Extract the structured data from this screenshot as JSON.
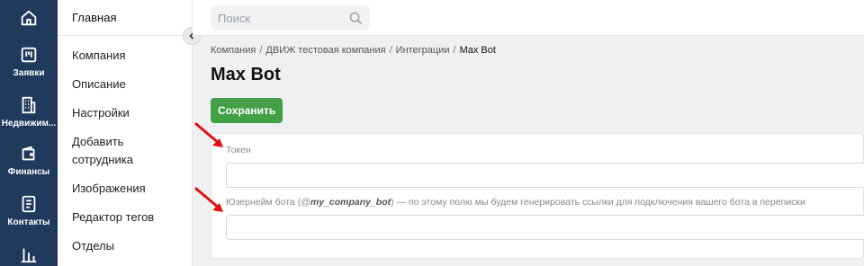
{
  "rail": {
    "items": [
      {
        "icon": "home-icon",
        "label": ""
      },
      {
        "icon": "board-icon",
        "label": "Заявки"
      },
      {
        "icon": "building-icon",
        "label": "Недвижим..."
      },
      {
        "icon": "wallet-icon",
        "label": "Финансы"
      },
      {
        "icon": "contacts-icon",
        "label": "Контакты"
      },
      {
        "icon": "chart-icon",
        "label": ""
      }
    ]
  },
  "sidebar": {
    "heading": "Главная",
    "items": [
      {
        "label": "Компания"
      },
      {
        "label": "Описание"
      },
      {
        "label": "Настройки"
      },
      {
        "label": "Добавить сотрудника"
      },
      {
        "label": "Изображения"
      },
      {
        "label": "Редактор тегов"
      },
      {
        "label": "Отделы"
      }
    ]
  },
  "search": {
    "placeholder": "Поиск"
  },
  "breadcrumb": [
    "Компания",
    "ДВИЖ тестовая компания",
    "Интеграции",
    "Max Bot"
  ],
  "page": {
    "title": "Max Bot",
    "save_label": "Сохранить"
  },
  "form": {
    "token_label": "Токен",
    "token_value": "",
    "username_label_prefix": "Юзернейм бота (@",
    "username_label_example": "my_company_bot",
    "username_label_suffix": ") — по этому полю мы будем генерировать ссылки для подключения вашего бота в переписки",
    "username_value": ""
  },
  "colors": {
    "rail_bg": "#1f3a5c",
    "save_button": "#43a047",
    "annotation_arrow": "#e01010"
  }
}
